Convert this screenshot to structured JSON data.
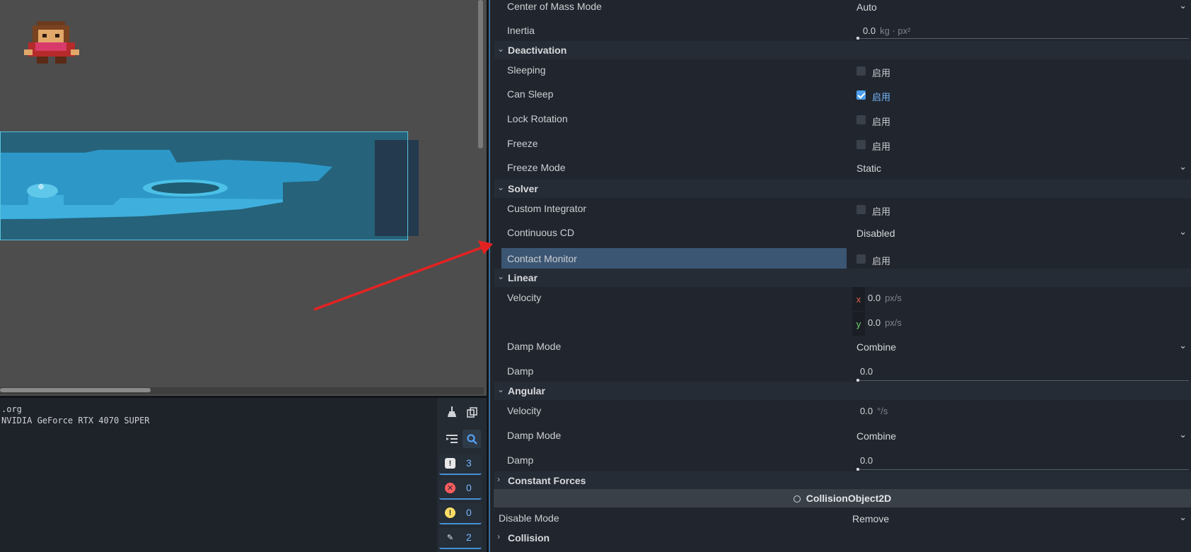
{
  "console": {
    "lines": [
      ".org",
      "NVIDIA GeForce RTX 4070 SUPER"
    ]
  },
  "filters": [
    {
      "icon": "message-icon",
      "count": "3"
    },
    {
      "icon": "error-icon",
      "count": "0"
    },
    {
      "icon": "warning-icon",
      "count": "0"
    },
    {
      "icon": "edit-icon",
      "count": "2"
    }
  ],
  "inspector": {
    "center_of_mass_mode": {
      "label": "Center of Mass Mode",
      "value": "Auto"
    },
    "inertia": {
      "label": "Inertia",
      "value": "0.0",
      "unit": "kg · px²"
    },
    "deactivation": {
      "title": "Deactivation",
      "sleeping": {
        "label": "Sleeping",
        "check": "启用",
        "checked": false
      },
      "can_sleep": {
        "label": "Can Sleep",
        "check": "启用",
        "checked": true
      },
      "lock_rotation": {
        "label": "Lock Rotation",
        "check": "启用",
        "checked": false
      },
      "freeze": {
        "label": "Freeze",
        "check": "启用",
        "checked": false
      },
      "freeze_mode": {
        "label": "Freeze Mode",
        "value": "Static"
      }
    },
    "solver": {
      "title": "Solver",
      "custom_integrator": {
        "label": "Custom Integrator",
        "check": "启用",
        "checked": false
      },
      "continuous_cd": {
        "label": "Continuous CD",
        "value": "Disabled"
      },
      "contact_monitor": {
        "label": "Contact Monitor",
        "check": "启用",
        "checked": false
      }
    },
    "linear": {
      "title": "Linear",
      "velocity": {
        "label": "Velocity",
        "x_axis": "x",
        "x": "0.0",
        "y_axis": "y",
        "y": "0.0",
        "unit": "px/s"
      },
      "damp_mode": {
        "label": "Damp Mode",
        "value": "Combine"
      },
      "damp": {
        "label": "Damp",
        "value": "0.0"
      }
    },
    "angular": {
      "title": "Angular",
      "velocity": {
        "label": "Velocity",
        "value": "0.0",
        "unit": "°/s"
      },
      "damp_mode": {
        "label": "Damp Mode",
        "value": "Combine"
      },
      "damp": {
        "label": "Damp",
        "value": "0.0"
      }
    },
    "constant_forces": {
      "title": "Constant Forces"
    },
    "collision_object": {
      "title": "CollisionObject2D",
      "disable_mode": {
        "label": "Disable Mode",
        "value": "Remove"
      },
      "collision": {
        "title": "Collision"
      }
    }
  },
  "colors": {
    "accent": "#4a9ff0",
    "annotation_arrow": "#e52222",
    "highlight_row": "#3b5673"
  }
}
